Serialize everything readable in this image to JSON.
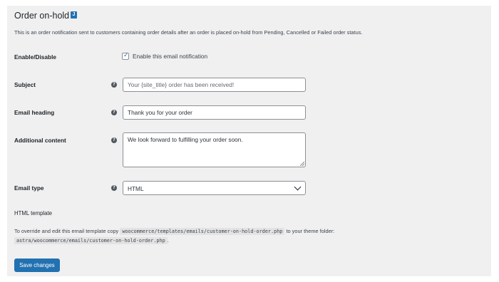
{
  "page": {
    "title": "Order on-hold",
    "badge": "J",
    "description": "This is an order notification sent to customers containing order details after an order is placed on-hold from Pending, Cancelled or Failed order status."
  },
  "form": {
    "enable": {
      "label": "Enable/Disable",
      "checkbox_label": "Enable this email notification",
      "checked": true
    },
    "subject": {
      "label": "Subject",
      "value": "",
      "placeholder": "Your {site_title} order has been received!"
    },
    "email_heading": {
      "label": "Email heading",
      "value": "Thank you for your order",
      "placeholder": ""
    },
    "additional_content": {
      "label": "Additional content",
      "value": "We look forward to fulfilling your order soon."
    },
    "email_type": {
      "label": "Email type",
      "selected": "HTML"
    }
  },
  "template": {
    "heading": "HTML template",
    "text_before": "To override and edit this email template copy",
    "source_path": "woocommerce/templates/emails/customer-on-hold-order.php",
    "text_after": "to your theme folder:",
    "target_path": "astra/woocommerce/emails/customer-on-hold-order.php",
    "text_end": "."
  },
  "actions": {
    "save_label": "Save changes"
  },
  "icons": {
    "help": "help-circle-icon",
    "check": "checkmark-icon",
    "dropdown": "chevron-down-icon"
  },
  "colors": {
    "accent": "#2271b1",
    "panel_bg": "#f0f0f1",
    "text": "#1d2327"
  }
}
